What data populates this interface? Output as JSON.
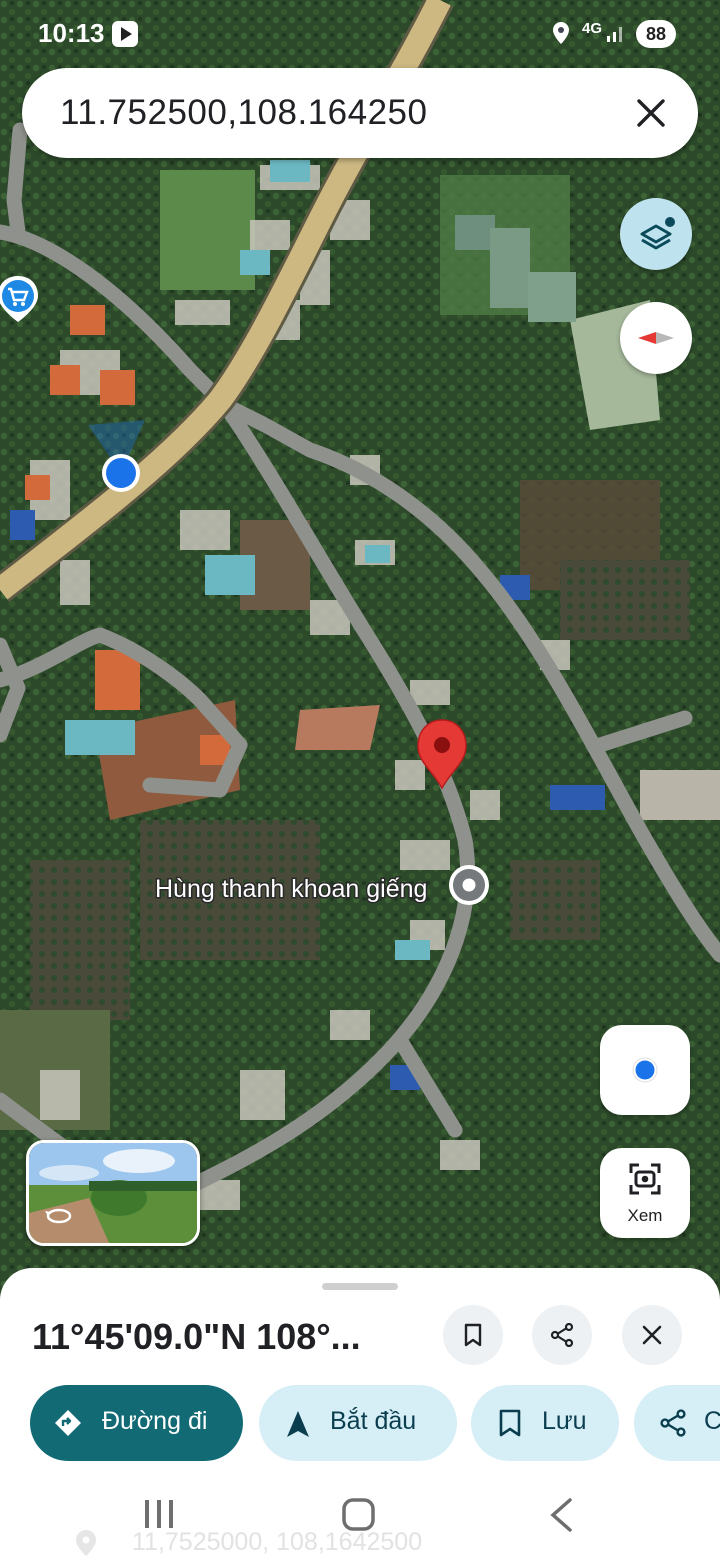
{
  "status_bar": {
    "time": "10:13",
    "network": "4G",
    "battery": "88"
  },
  "search": {
    "query": "11.752500,108.164250"
  },
  "map": {
    "place_label": "Hùng thanh khoan giếng",
    "colors": {
      "main_road": "#cdb882",
      "local_road": "#8f918c",
      "pin": "#e53935",
      "location_dot": "#1a73e8"
    }
  },
  "controls": {
    "view_label": "Xem"
  },
  "sheet": {
    "title": "11°45'09.0\"N 108°...",
    "chips": [
      {
        "label": "Đường đi",
        "icon": "directions-icon"
      },
      {
        "label": "Bắt đầu",
        "icon": "navigation-arrow-icon"
      },
      {
        "label": "Lưu",
        "icon": "bookmark-icon"
      },
      {
        "label": "C",
        "icon": "share-icon"
      }
    ]
  },
  "footer_ghost": "11,7525000, 108,1642500"
}
